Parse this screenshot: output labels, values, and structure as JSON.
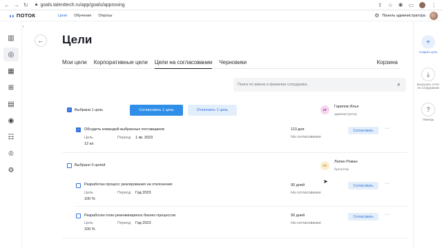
{
  "browser": {
    "url": "goals.talenttech.ru/app/goals/approving"
  },
  "app": {
    "logo": "ПОТОК",
    "nav": [
      "Цели",
      "Обучение",
      "Опросы"
    ],
    "admin_panel": "Панель администратора"
  },
  "page": {
    "title": "Цели",
    "tabs": [
      "Мои цели",
      "Корпоративные цели",
      "Цели на согласовании",
      "Черновики"
    ],
    "tab_right": "Корзина",
    "search_placeholder": "Поиск по имени и фамилии сотрудника"
  },
  "rail": {
    "create_label": "Создать цель",
    "export_label": "Выгрузить отчет по сотрудникам",
    "help_label": "Помощь"
  },
  "groups": [
    {
      "selected_text": "Выбрана 1 цель",
      "approve_btn": "Согласовать 1 цель",
      "reject_btn": "Отклонить 1 цель",
      "employee": {
        "initials": "ИГ",
        "name": "Гарипов Илья",
        "role": "администратор",
        "color": "#f5d6ef",
        "text_color": "#b23a98"
      },
      "goals": [
        {
          "title": "Обсудить командой выбранных поставщиков",
          "type_label": "Цель",
          "value": "12 кл.",
          "period_label": "Период",
          "period": "1 кв. 2023",
          "days": "113 дня",
          "status": "На согласовании",
          "action": "Согласовать",
          "checked": true
        }
      ]
    },
    {
      "selected_text": "Выбрано 0 целей",
      "employee": {
        "initials": "РЛ",
        "name": "Лапин Роман",
        "role": "бухгалтер",
        "color": "#fbeecf",
        "text_color": "#c79a2a"
      },
      "goals": [
        {
          "title": "Разработан процесс реагирования на отклонения",
          "type_label": "Цель",
          "value": "100 %",
          "period_label": "Период",
          "period": "Год 2023",
          "days": "90 дней",
          "status": "На согласовании",
          "action": "Согласовать",
          "checked": false
        },
        {
          "title": "Разработан план реинжиниринга бизнес-процессов",
          "type_label": "Цель",
          "value": "100 %",
          "period_label": "Период",
          "period": "Год 2023",
          "days": "90 дней",
          "status": "На согласовании",
          "action": "Согласовать",
          "checked": false
        }
      ]
    }
  ]
}
